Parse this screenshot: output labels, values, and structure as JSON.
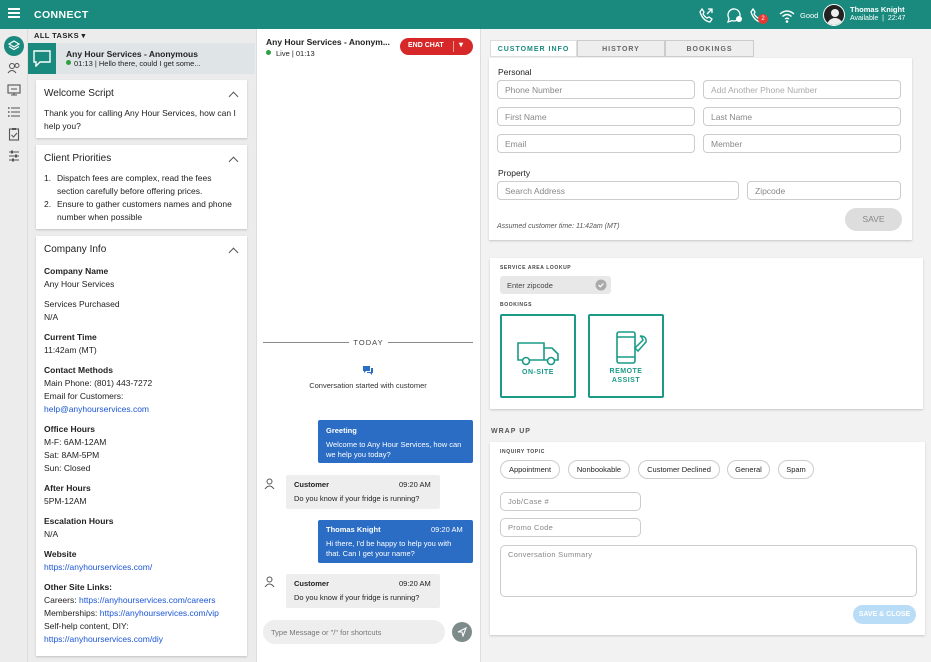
{
  "app": {
    "title": "CONNECT"
  },
  "header": {
    "calls_badge": "2",
    "network_status": "Good",
    "user": {
      "name": "Thomas Knight",
      "status": "Available",
      "time": "22:47"
    }
  },
  "tasks": {
    "label": "ALL TASKS",
    "active": {
      "name": "Any Hour Services - Anonymous",
      "preview": "01:13 | Hello there, could I get some..."
    }
  },
  "welcome": {
    "title": "Welcome Script",
    "text": "Thank you for calling Any Hour Services, how can I help you?"
  },
  "priorities": {
    "title": "Client Priorities",
    "items": [
      "Dispatch fees are complex, read the fees section carefully before offering prices.",
      "Ensure to gather customers names and phone number when possible"
    ]
  },
  "company": {
    "title": "Company Info",
    "name_label": "Company Name",
    "name": "Any Hour Services",
    "services_label": "Services Purchased",
    "services": "N/A",
    "time_label": "Current Time",
    "time": "11:42am (MT)",
    "contact_label": "Contact Methods",
    "phone": "Main Phone: (801) 443-7272",
    "email_label": "Email for Customers:",
    "email": "help@anyhourservices.com",
    "office_label": "Office Hours",
    "office": [
      "M-F: 6AM-12AM",
      "Sat: 8AM-5PM",
      "Sun: Closed"
    ],
    "after_label": "After Hours",
    "after": "5PM-12AM",
    "escalation_label": "Escalation Hours",
    "escalation": "N/A",
    "website_label": "Website",
    "website": "https://anyhourservices.com/",
    "links_label": "Other Site Links:",
    "careers_label": "Careers:",
    "careers": "https://anyhourservices.com/careers",
    "memberships_label": "Memberships:",
    "memberships": "https://anyhourservices.com/vip",
    "selfhelp_label": "Self-help content, DIY:",
    "selfhelp": "https://anyhourservices.com/diy"
  },
  "chat": {
    "title": "Any Hour Services - Anonym...",
    "status": "Live | 01:13",
    "end_label": "END CHAT",
    "divider": "TODAY",
    "started": "Conversation started with customer",
    "messages": [
      {
        "sender": "Greeting",
        "time": "",
        "text": "Welcome to Any Hour Services, how can we help you today?"
      },
      {
        "sender": "Customer",
        "time": "09:20 AM",
        "text": "Do you know if your fridge is running?"
      },
      {
        "sender": "Thomas Knight",
        "time": "09:20 AM",
        "text": "Hi there, I'd be happy to help you with that. Can I get your name?"
      },
      {
        "sender": "Customer",
        "time": "09:20 AM",
        "text": "Do you know if your fridge is running?"
      }
    ],
    "input_placeholder": "Type Message or \"/\" for shortcuts"
  },
  "customer": {
    "tabs": [
      "CUSTOMER INFO",
      "HISTORY",
      "BOOKINGS"
    ],
    "personal": "Personal",
    "phone": "Phone Number",
    "phone2": "Add Another Phone Number",
    "first": "First Name",
    "last": "Last Name",
    "email": "Email",
    "member": "Member",
    "property": "Property",
    "address": "Search Address",
    "zip": "Zipcode",
    "note": "Assumed customer time: 11:42am (MT)",
    "save": "SAVE"
  },
  "service": {
    "lookup_label": "SERVICE AREA LOOKUP",
    "zip_placeholder": "Enter zipcode",
    "bookings_label": "BOOKINGS",
    "onsite": "ON-SITE",
    "remote": [
      "REMOTE",
      "ASSIST"
    ]
  },
  "wrapup": {
    "title": "WRAP UP",
    "topic_label": "INQUIRY TOPIC",
    "chips": [
      "Appointment",
      "Nonbookable",
      "Customer Declined",
      "General",
      "Spam"
    ],
    "job": "Job/Case #",
    "promo": "Promo Code",
    "summary": "Conversation Summary",
    "save_close": "SAVE & CLOSE"
  }
}
